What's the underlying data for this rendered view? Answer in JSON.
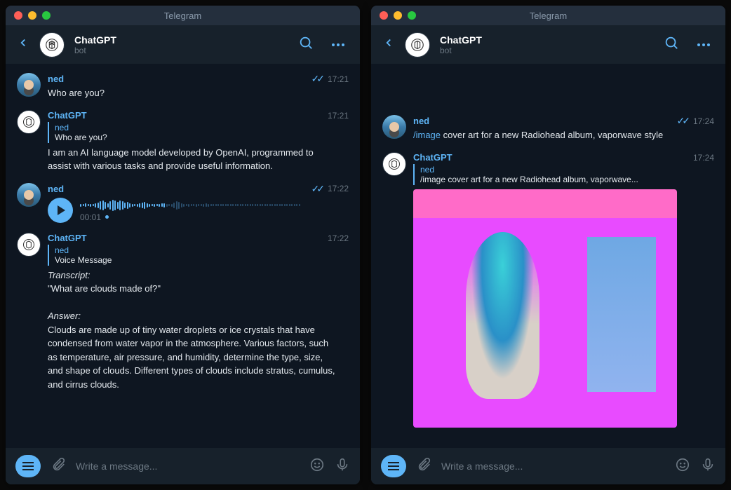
{
  "app_title": "Telegram",
  "chat": {
    "name": "ChatGPT",
    "subtitle": "bot"
  },
  "composer": {
    "placeholder": "Write a message..."
  },
  "left": {
    "m1": {
      "name": "ned",
      "text": "Who are you?",
      "time": "17:21"
    },
    "m2": {
      "name": "ChatGPT",
      "time": "17:21",
      "reply_name": "ned",
      "reply_text": "Who are you?",
      "text": "I am an AI language model developed by OpenAI, programmed to assist with various tasks and provide useful information."
    },
    "m3": {
      "name": "ned",
      "time": "17:22",
      "duration": "00:01"
    },
    "m4": {
      "name": "ChatGPT",
      "time": "17:22",
      "reply_name": "ned",
      "reply_text": "Voice Message",
      "transcript_label": "Transcript:",
      "transcript": "\"What are clouds made of?\"",
      "answer_label": "Answer:",
      "answer": "Clouds are made up of tiny water droplets or ice crystals that have condensed from water vapor in the atmosphere. Various factors, such as temperature, air pressure, and humidity, determine the type, size, and shape of clouds. Different types of clouds include stratus, cumulus, and cirrus clouds."
    }
  },
  "right": {
    "m1": {
      "name": "ned",
      "time": "17:24",
      "cmd": "/image",
      "rest": " cover art for a new Radiohead album, vaporwave style"
    },
    "m2": {
      "name": "ChatGPT",
      "time": "17:24",
      "reply_name": "ned",
      "reply_text": "/image cover art for a new Radiohead album, vaporwave..."
    }
  }
}
